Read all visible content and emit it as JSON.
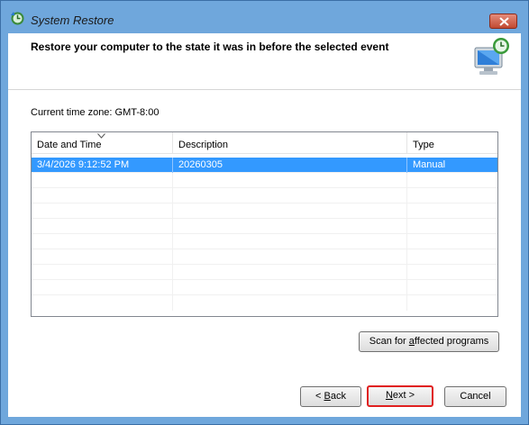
{
  "window": {
    "title": "System Restore",
    "close_icon": "close-icon"
  },
  "header": {
    "text": "Restore your computer to the state it was in before the selected event",
    "icon": "system-restore-monitor-icon"
  },
  "timezone": {
    "label": "Current time zone: GMT-8:00"
  },
  "restore_points": {
    "columns": [
      "Date and Time",
      "Description",
      "Type"
    ],
    "sorted_column": "Date and Time",
    "rows": [
      {
        "date_time": "3/4/2026 9:12:52 PM",
        "description": "20260305",
        "type": "Manual",
        "selected": true
      }
    ]
  },
  "buttons": {
    "scan_pre": "Scan for ",
    "scan_u": "a",
    "scan_post": "ffected programs",
    "back_pre": "< ",
    "back_u": "B",
    "back_post": "ack",
    "next_pre": "",
    "next_u": "N",
    "next_post": "ext >",
    "cancel": "Cancel"
  },
  "colors": {
    "titlebar": "#6fa7dc",
    "selection": "#3399ff",
    "highlight_border": "#e02020"
  }
}
